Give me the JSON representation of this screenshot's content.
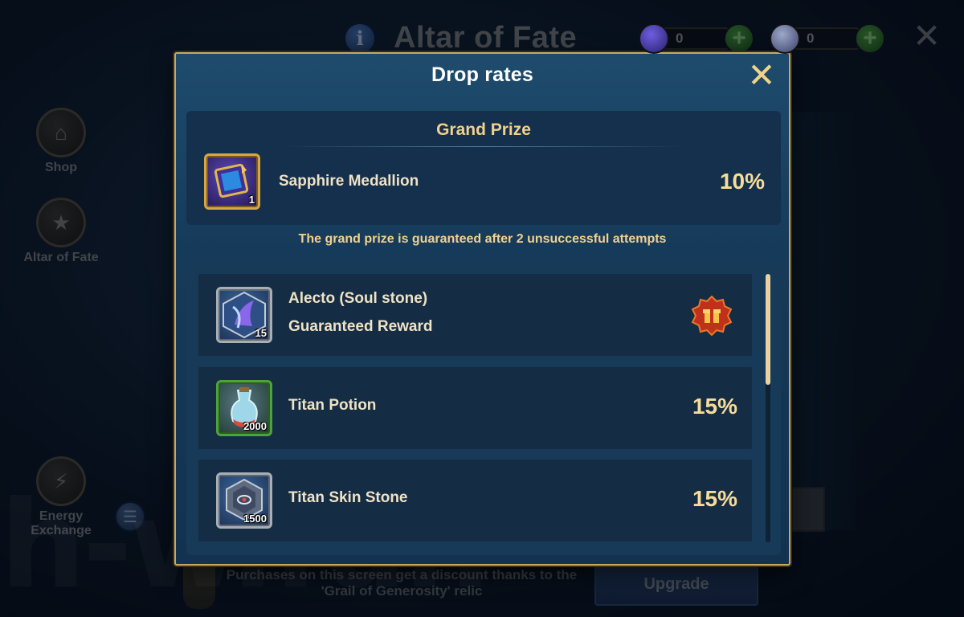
{
  "background": {
    "title": "Altar of Fate",
    "info_icon": "info-icon",
    "currency": [
      {
        "icon": "emerald-gem-icon",
        "value": "0"
      },
      {
        "icon": "crystal-gem-icon",
        "value": "0"
      }
    ],
    "sidebar": [
      {
        "label": "Shop",
        "icon": "shop-icon"
      },
      {
        "label": "Altar of Fate",
        "icon": "pentagon-star-icon"
      },
      {
        "label": "Energy Exchange",
        "icon": "lightning-exchange-icon"
      }
    ],
    "footnote": "Purchases on this screen get a discount thanks to the 'Grail of Generosity' relic",
    "upgrade_label": "Upgrade",
    "watermark": "h-w.fun"
  },
  "modal": {
    "title": "Drop rates",
    "grand_prize": {
      "heading": "Grand Prize",
      "item": {
        "name": "Sapphire Medallion",
        "count": "1",
        "rate": "10%",
        "icon": "sapphire-medallion-icon"
      }
    },
    "guarantee_note": "The grand prize is guaranteed after 2 unsuccessful attempts",
    "items": [
      {
        "name": "Alecto (Soul stone)",
        "subtitle": "Guaranteed Reward",
        "count": "15",
        "rate": "",
        "icon": "alecto-soul-stone-icon"
      },
      {
        "name": "Titan Potion",
        "subtitle": "",
        "count": "2000",
        "rate": "15%",
        "icon": "titan-potion-icon"
      },
      {
        "name": "Titan Skin Stone",
        "subtitle": "",
        "count": "1500",
        "rate": "15%",
        "icon": "titan-skin-stone-icon"
      }
    ]
  },
  "colors": {
    "accent_gold": "#f3d18d",
    "modal_border": "#c9a765",
    "modal_bg": "#1e4b6d"
  }
}
